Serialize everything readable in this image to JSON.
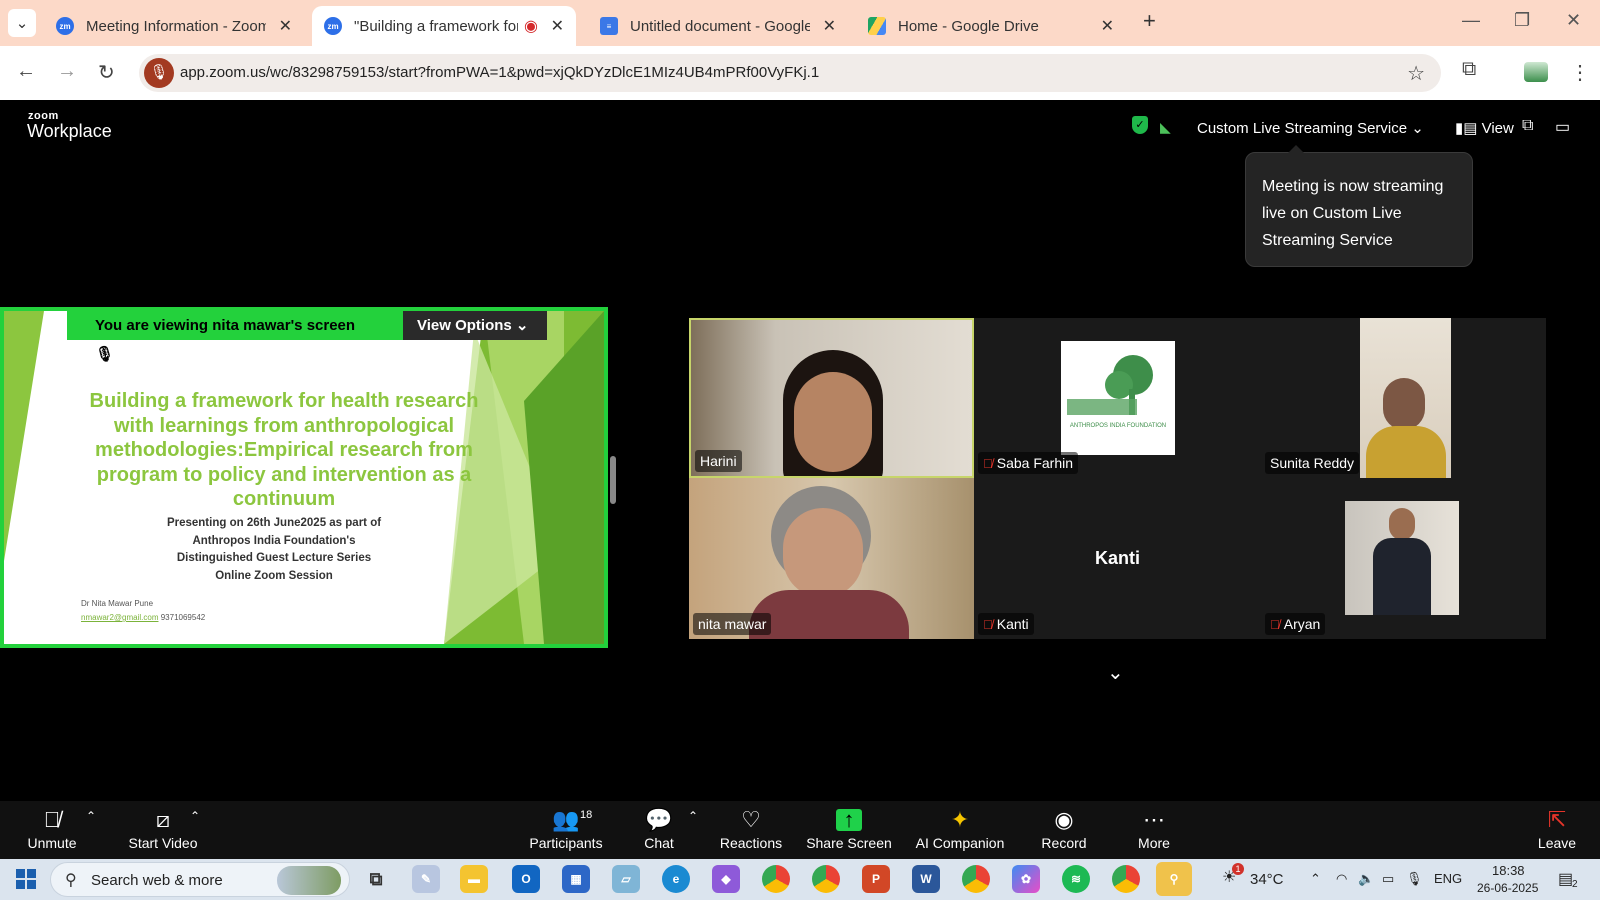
{
  "browser": {
    "tabs": [
      {
        "title": "Meeting Information - Zoom",
        "active": false
      },
      {
        "title": "\"Building a framework for h",
        "active": true
      },
      {
        "title": "Untitled document - Google Do",
        "active": false
      },
      {
        "title": "Home - Google Drive",
        "active": false
      }
    ],
    "url": "app.zoom.us/wc/83298759153/start?fromPWA=1&pwd=xjQkDYzDlcE1MIz4UB4mPRf00VyFKj.1"
  },
  "zoom_header": {
    "logo_small": "zoom",
    "logo_big": "Workplace",
    "streaming_label": "Custom Live Streaming Service",
    "view_label": "View"
  },
  "tooltip": {
    "text": "Meeting is now streaming live on Custom Live Streaming Service"
  },
  "share": {
    "viewing_label": "You are viewing  nita mawar's screen",
    "view_options": "View Options",
    "slide_title": "Building a framework for health research with learnings from anthropological methodologies:Empirical research from program to policy and intervention as a continuum",
    "slide_sub1": "Presenting on 26th June2025 as part of",
    "slide_sub2": "Anthropos India Foundation's",
    "slide_sub3": "Distinguished Guest Lecture Series",
    "slide_sub4": "Online Zoom Session",
    "author": "Dr Nita Mawar Pune",
    "email": "nmawar2@gmail.com",
    "phone": "9371069542"
  },
  "participants_grid": [
    {
      "name": "Harini",
      "muted": false
    },
    {
      "name": "Saba Farhin",
      "muted": true,
      "logo_text": "ANTHROPOS INDIA FOUNDATION"
    },
    {
      "name": "Sunita Reddy",
      "muted": false
    },
    {
      "name": "nita mawar",
      "muted": false
    },
    {
      "name": "Kanti",
      "muted": true,
      "center_label": "Kanti"
    },
    {
      "name": "Aryan",
      "muted": true
    }
  ],
  "toolbar": {
    "unmute": "Unmute",
    "start_video": "Start Video",
    "participants": "Participants",
    "participants_count": "18",
    "chat": "Chat",
    "reactions": "Reactions",
    "share_screen": "Share Screen",
    "ai_companion": "AI Companion",
    "record": "Record",
    "more": "More",
    "leave": "Leave"
  },
  "taskbar": {
    "search_placeholder": "Search web & more",
    "weather": "34°C",
    "language": "ENG",
    "time": "18:38",
    "date": "26-06-2025",
    "notification_count": "2",
    "weather_badge": "1"
  },
  "colors": {
    "zoom_green": "#23d13c",
    "slide_green": "#8cc63f",
    "tab_bar": "#fcd9c8",
    "mute_red": "#e5342a"
  }
}
